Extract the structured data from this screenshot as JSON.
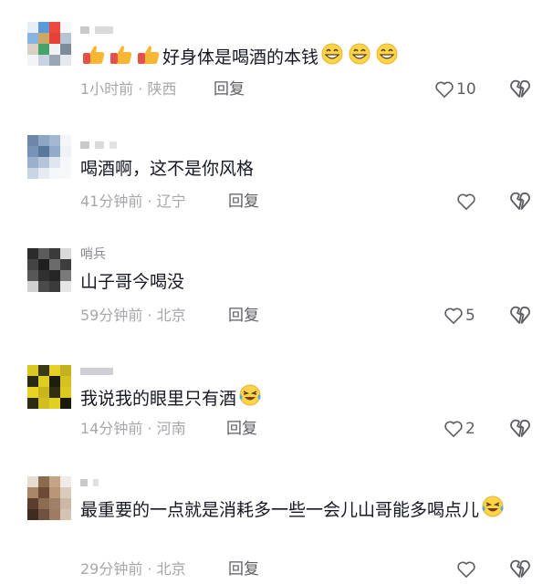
{
  "comments": [
    {
      "name": "",
      "text": "好身体是喝酒的本钱",
      "time": "1小时前 · 陕西",
      "reply_label": "回复",
      "likes": "10",
      "avatar_colors": [
        "#e8eef5",
        "#5a9bd6",
        "#e84c3d",
        "#f5f7fa",
        "#8ab4e0",
        "#c9a86a",
        "#e0433a",
        "#b8c4d0",
        "#d9d2c5",
        "#4aa36a",
        "#f0f2f5",
        "#7d8a99",
        "#f2f4f7",
        "#c7d3df",
        "#9aa6b3",
        "#e5e8ec"
      ]
    },
    {
      "name": "",
      "text": "喝酒啊，这不是你风格",
      "time": "41分钟前 · 辽宁",
      "reply_label": "回复",
      "likes": "",
      "avatar_colors": [
        "#6d87a8",
        "#8fa6c4",
        "#a3b7d1",
        "#f3f5f8",
        "#7893b5",
        "#5a7699",
        "#93abc8",
        "#eef1f5",
        "#9cb0c9",
        "#b5c5d8",
        "#dfe6ee",
        "#f5f7fa",
        "#c9d4e1",
        "#e5ebf1",
        "#f5f7fa",
        "#f7f8fa"
      ]
    },
    {
      "name": "哨兵",
      "text": "山子哥今喝没",
      "time": "59分钟前 · 北京",
      "reply_label": "回复",
      "likes": "5",
      "avatar_colors": [
        "#2b2b2b",
        "#5c5c5c",
        "#3a3a3a",
        "#d9d9d9",
        "#444444",
        "#1f1f1f",
        "#6b6b6b",
        "#3d3d3d",
        "#575757",
        "#303030",
        "#262626",
        "#7a7a7a",
        "#d0d0d0",
        "#4a4a4a",
        "#3b3b3b",
        "#e6e6e6"
      ]
    },
    {
      "name": "",
      "text": "我说我的眼里只有酒",
      "time": "14分钟前 · 河南",
      "reply_label": "回复",
      "likes": "2",
      "avatar_colors": [
        "#d9c82a",
        "#3a3a1a",
        "#e6d12c",
        "#c2b226",
        "#2a2a12",
        "#e0cc2a",
        "#1e1e0e",
        "#d4c228",
        "#e8d42e",
        "#c8b626",
        "#302e14",
        "#dcc82a",
        "#2c2a12",
        "#d0be28",
        "#e2ce2c",
        "#1a1a0c"
      ]
    },
    {
      "name": "",
      "text": "最重要的一点就是消耗多一些一会儿山哥能多喝点儿",
      "time": "29分钟前 · 北京",
      "reply_label": "回复",
      "likes": "",
      "avatar_colors": [
        "#e6dcd2",
        "#8a6a50",
        "#c4a488",
        "#f0ebe6",
        "#a88468",
        "#6b4a34",
        "#b8967a",
        "#d8cbbf",
        "#5a3e2c",
        "#8c6c52",
        "#a0806a",
        "#cbb8a6",
        "#3e2c20",
        "#6e5240",
        "#9c7c64",
        "#d4c4b4"
      ]
    }
  ]
}
